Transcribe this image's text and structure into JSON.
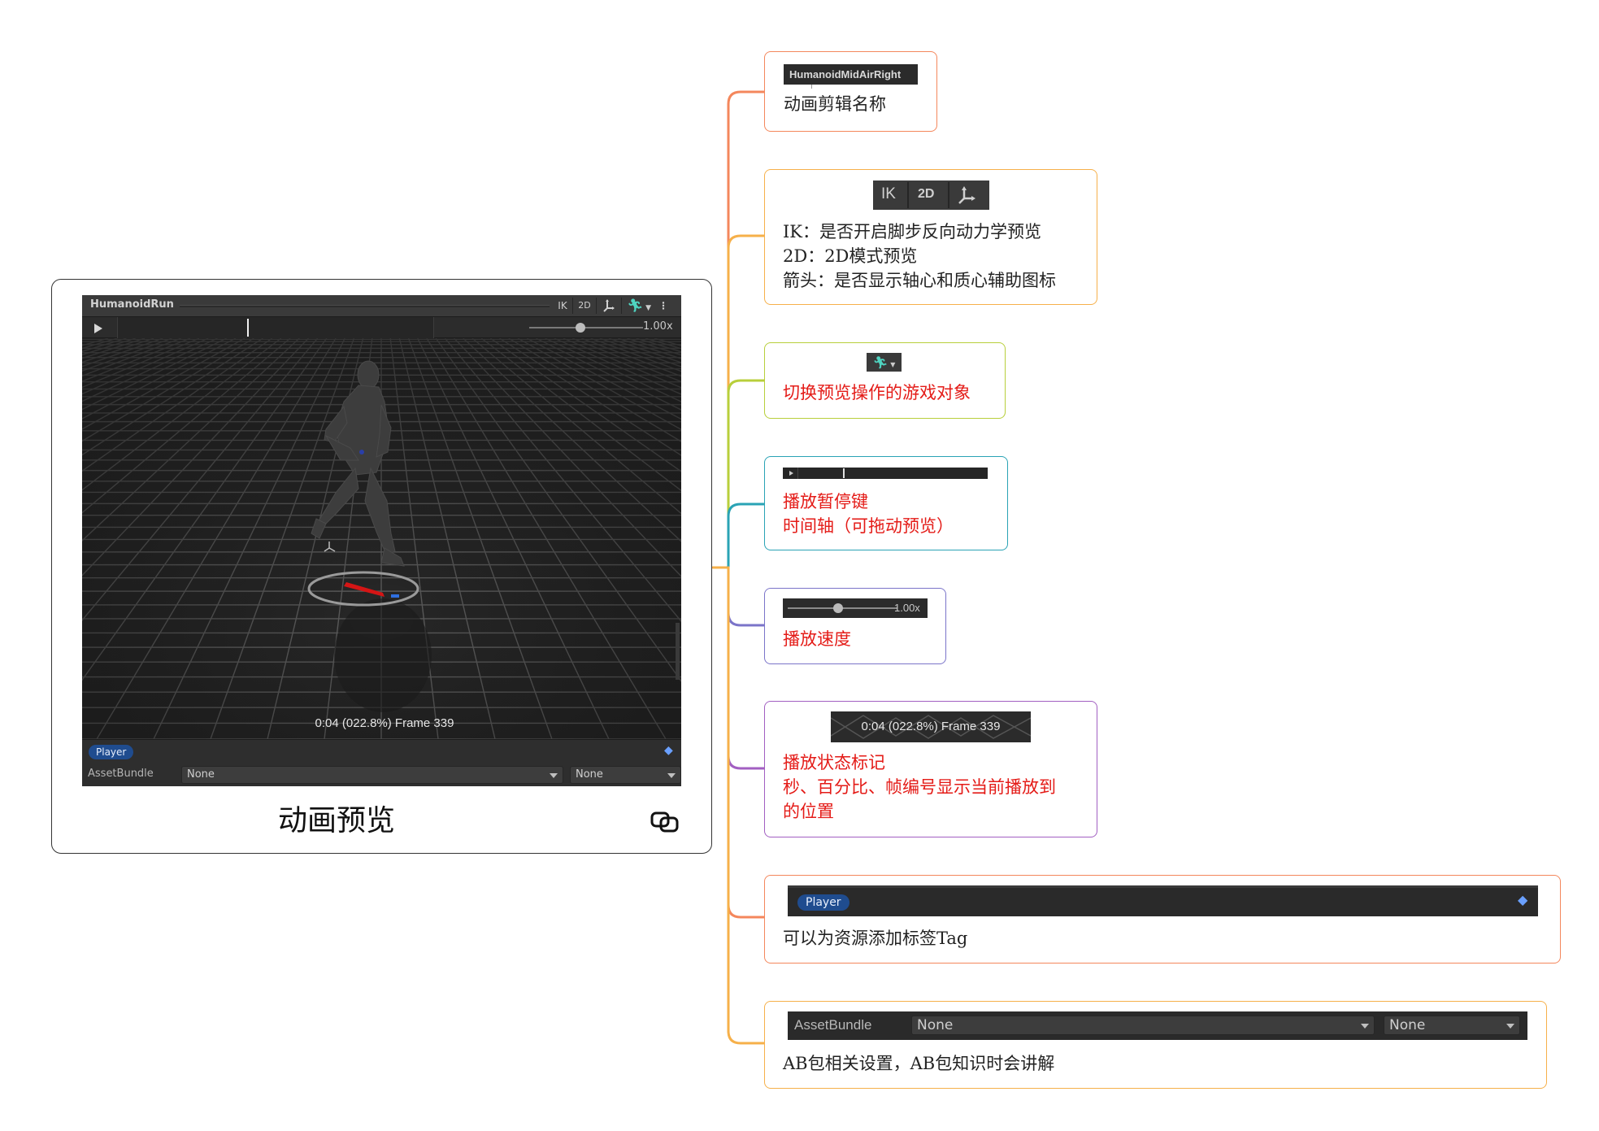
{
  "card": {
    "title": "动画预览",
    "window": {
      "clip_name": "HumanoidRun",
      "ik_label": "IK",
      "mode_2d_label": "2D",
      "speed_label": "1.00x",
      "status": "0:04 (022.8%) Frame 339",
      "tag_label": "Player",
      "assetbundle_label": "AssetBundle",
      "bundle_name": "None",
      "bundle_variant": "None"
    }
  },
  "annotations": [
    {
      "id": "clip-name",
      "image_text": "HumanoidMidAirRight",
      "lines": [
        "动画剪辑名称"
      ],
      "color": "#f4875c"
    },
    {
      "id": "ik-2d-pivot",
      "image_ik": "IK",
      "image_2d": "2D",
      "lines": [
        "IK：是否开启脚步反向动力学预览",
        "2D：2D模式预览",
        "箭头：是否显示轴心和质心辅助图标"
      ],
      "color": "#f6b04a"
    },
    {
      "id": "avatar-switch",
      "lines": [
        "切换预览操作的游戏对象"
      ],
      "color": "#b8cf3b"
    },
    {
      "id": "play-timeline",
      "lines": [
        "播放暂停键",
        "时间轴（可拖动预览）"
      ],
      "color": "#2aa3b5"
    },
    {
      "id": "playback-speed",
      "image_speed": "1.00x",
      "lines": [
        "播放速度"
      ],
      "color": "#7b74c9"
    },
    {
      "id": "status",
      "image_status": "0:04 (022.8%) Frame 339",
      "lines": [
        "播放状态标记",
        "秒、百分比、帧编号显示当前播放到",
        "的位置"
      ],
      "color": "#a25fc2"
    },
    {
      "id": "tag",
      "image_tag": "Player",
      "lines": [
        "可以为资源添加标签Tag"
      ],
      "color": "#f4875c"
    },
    {
      "id": "assetbundle",
      "image_label": "AssetBundle",
      "image_name": "None",
      "image_variant": "None",
      "lines": [
        "AB包相关设置，AB包知识时会讲解"
      ],
      "color": "#f6b04a"
    }
  ]
}
